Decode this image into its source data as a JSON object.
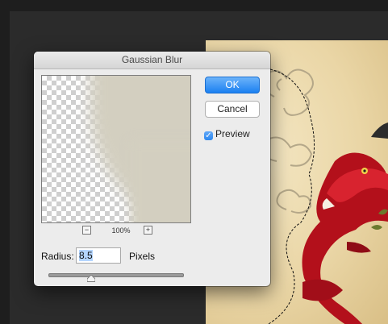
{
  "dialog": {
    "title": "Gaussian Blur",
    "ok_label": "OK",
    "cancel_label": "Cancel",
    "preview_label": "Preview",
    "preview_checked": true,
    "zoom_level": "100%",
    "zoom_out_symbol": "−",
    "zoom_in_symbol": "+",
    "radius_label": "Radius:",
    "radius_value": "8.5",
    "units_label": "Pixels",
    "slider_level_fraction": 0.32
  },
  "colors": {
    "accent": "#1b80f1",
    "dialog_bg": "#ececec",
    "preview_tint": "#d3cfc0",
    "dragon_red": "#c1121f"
  },
  "icons": {
    "check": "checkmark-icon",
    "slider_thumb": "slider-thumb-icon"
  }
}
